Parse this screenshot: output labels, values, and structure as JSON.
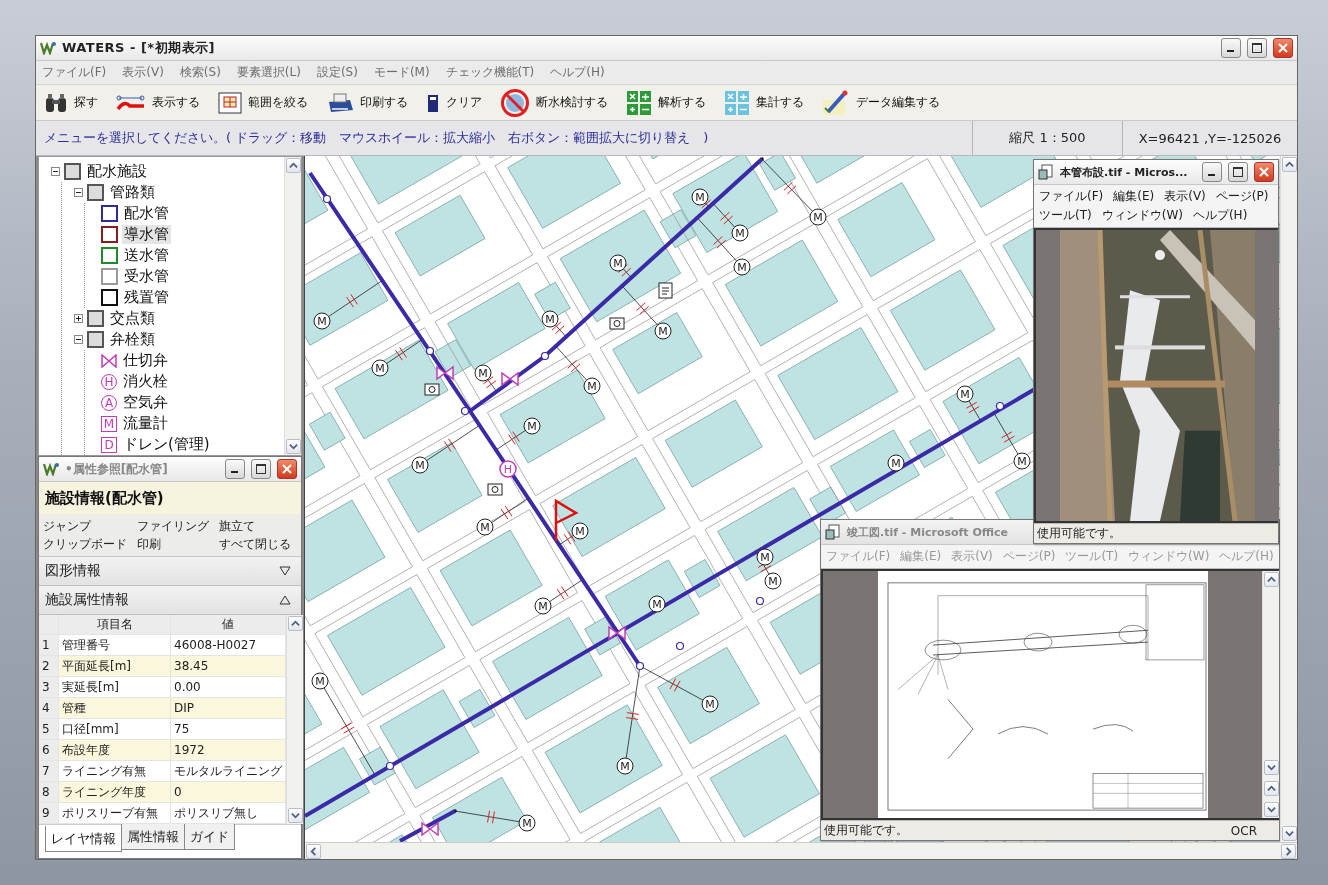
{
  "window": {
    "title": "WATERS - [*初期表示]"
  },
  "menu": [
    "ファイル(F)",
    "表示(V)",
    "検索(S)",
    "要素選択(L)",
    "設定(S)",
    "モード(M)",
    "チェック機能(T)",
    "ヘルプ(H)"
  ],
  "toolbar": [
    "探す",
    "表示する",
    "範囲を絞る",
    "印刷する",
    "クリア",
    "断水検討する",
    "解析する",
    "集計する",
    "データ編集する"
  ],
  "hint": "メニューを選択してください。( ドラッグ：移動　マウスホイール：拡大縮小　右ボタン：範囲拡大に切り替え　)",
  "scale": "縮尺 1：500",
  "coords": "X=96421 ,Y=-125026",
  "tree": [
    {
      "label": "配水施設",
      "kind": "group",
      "checked": false,
      "selected": false,
      "expanded": true,
      "children": [
        {
          "label": "管路類",
          "kind": "group",
          "checked": false,
          "selected": false,
          "expanded": true,
          "children": [
            {
              "label": "配水管",
              "kind": "pipe",
              "color": "#2c2ca0",
              "selected": false
            },
            {
              "label": "導水管",
              "kind": "pipe",
              "color": "#8a1c1c",
              "selected": true
            },
            {
              "label": "送水管",
              "kind": "pipe",
              "color": "#1e8a2a",
              "selected": false
            },
            {
              "label": "受水管",
              "kind": "pipe",
              "color": "#9a9a9a",
              "selected": false
            },
            {
              "label": "残置管",
              "kind": "pipe",
              "color": "#111111",
              "selected": false
            }
          ]
        },
        {
          "label": "交点類",
          "kind": "group",
          "checked": false,
          "selected": false,
          "expanded": false
        },
        {
          "label": "弁栓類",
          "kind": "group",
          "checked": false,
          "selected": false,
          "expanded": true,
          "children": [
            {
              "label": "仕切弁",
              "kind": "valve",
              "selected": false
            },
            {
              "label": "消火栓",
              "kind": "circle",
              "symbol": "H",
              "selected": false
            },
            {
              "label": "空気弁",
              "kind": "circle",
              "symbol": "A",
              "selected": false
            },
            {
              "label": "流量計",
              "kind": "square",
              "symbol": "M",
              "selected": false
            },
            {
              "label": "ドレン(管理)",
              "kind": "square",
              "symbol": "D",
              "selected": false
            }
          ]
        }
      ]
    }
  ],
  "properties": {
    "title": "•属性参照[配水管]",
    "heading": "施設情報(配水管)",
    "actions": [
      "ジャンプ",
      "ファイリング",
      "旗立て",
      "クリップボード",
      "印刷",
      "すべて閉じる"
    ],
    "sections": [
      {
        "label": "図形情報",
        "expanded": false
      },
      {
        "label": "施設属性情報",
        "expanded": true
      }
    ],
    "columns": [
      "項目名",
      "値"
    ],
    "rows": [
      {
        "no": "1",
        "name": "管理番号",
        "value": "46008-H0027"
      },
      {
        "no": "2",
        "name": "平面延長[m]",
        "value": "38.45"
      },
      {
        "no": "3",
        "name": "実延長[m]",
        "value": "0.00"
      },
      {
        "no": "4",
        "name": "管種",
        "value": "DIP"
      },
      {
        "no": "5",
        "name": "口径[mm]",
        "value": "75"
      },
      {
        "no": "6",
        "name": "布設年度",
        "value": "1972"
      },
      {
        "no": "7",
        "name": "ライニング有無",
        "value": "モルタルライニング"
      },
      {
        "no": "8",
        "name": "ライニング年度",
        "value": "0"
      },
      {
        "no": "9",
        "name": "ポリスリーブ有無",
        "value": "ポリスリブ無し"
      }
    ],
    "tabs": [
      {
        "label": "レイヤ情報",
        "selected": true
      },
      {
        "label": "属性情報",
        "selected": false
      },
      {
        "label": "ガイド",
        "selected": false
      }
    ]
  },
  "map": {
    "meters": [
      "M",
      "M",
      "M",
      "M",
      "M",
      "M",
      "M",
      "M",
      "M",
      "M",
      "M",
      "M",
      "M",
      "M",
      "M",
      "M",
      "M",
      "M",
      "M",
      "M",
      "M",
      "M",
      "M",
      "M",
      "M",
      "M"
    ],
    "hydrant_symbol": "H"
  },
  "viewers": [
    {
      "title": "本管布設.tif - Micros...",
      "active": true,
      "menu": [
        "ファイル(F)",
        "編集(E)",
        "表示(V)",
        "ページ(P)",
        "ツール(T)",
        "ウィンドウ(W)",
        "ヘルプ(H)"
      ],
      "status": "使用可能です。"
    },
    {
      "title": "竣工図.tif - Microsoft Office",
      "active": false,
      "menu": [
        "ファイル(F)",
        "編集(E)",
        "表示(V)",
        "ページ(P)",
        "ツール(T)",
        "ウィンドウ(W)",
        "ヘルプ(H)"
      ],
      "status": "使用可能です。",
      "status_right": "OCR"
    }
  ]
}
